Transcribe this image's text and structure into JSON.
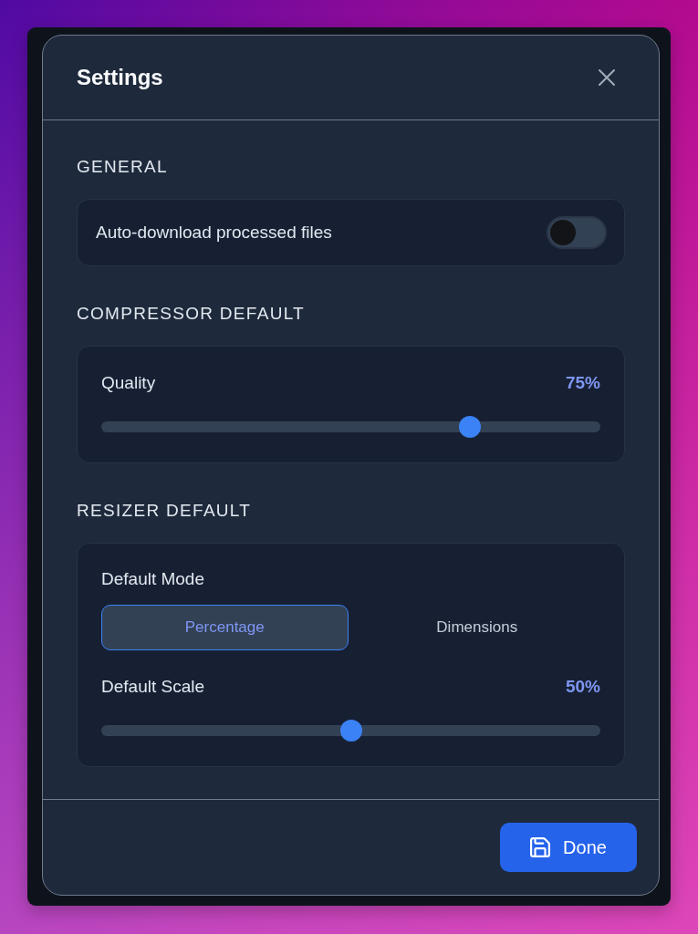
{
  "dialog": {
    "title": "Settings"
  },
  "sections": [
    {
      "heading": "GENERAL",
      "items": [
        {
          "kind": "toggle",
          "label": "Auto-download processed files",
          "on": false
        }
      ]
    },
    {
      "heading": "COMPRESSOR DEFAULT",
      "items": [
        {
          "kind": "slider",
          "label": "Quality",
          "reading": "75%",
          "level": 0.75
        }
      ]
    },
    {
      "heading": "RESIZER DEFAULT",
      "items": [
        {
          "kind": "segmented",
          "label": "Default Mode",
          "options": [
            {
              "label": "Percentage",
              "selected": true
            },
            {
              "label": "Dimensions",
              "selected": false
            }
          ]
        },
        {
          "kind": "slider",
          "label": "Default Scale",
          "reading": "50%",
          "level": 0.5
        }
      ]
    }
  ],
  "footer": {
    "done_button": {
      "label": "Done"
    }
  }
}
